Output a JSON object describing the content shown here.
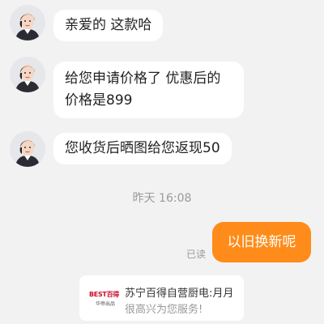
{
  "messages": [
    {
      "text": "亲爱的 这款哈"
    },
    {
      "text": "给您申请价格了  优惠后的价格是899"
    },
    {
      "text": "您收货后晒图给您返现50"
    }
  ],
  "timestamp": "昨天 16:08",
  "outgoing": {
    "text": "以旧换新呢",
    "status": "已读"
  },
  "shop_card": {
    "logo_text": "BEST百得",
    "logo_subtext": "华帝出品",
    "title": "苏宁百得自营厨电:月月",
    "subtitle": "很高兴为您服务!"
  },
  "colors": {
    "accent": "#ff8c1a",
    "background": "#f2f2f2",
    "bubble": "#ffffff"
  }
}
